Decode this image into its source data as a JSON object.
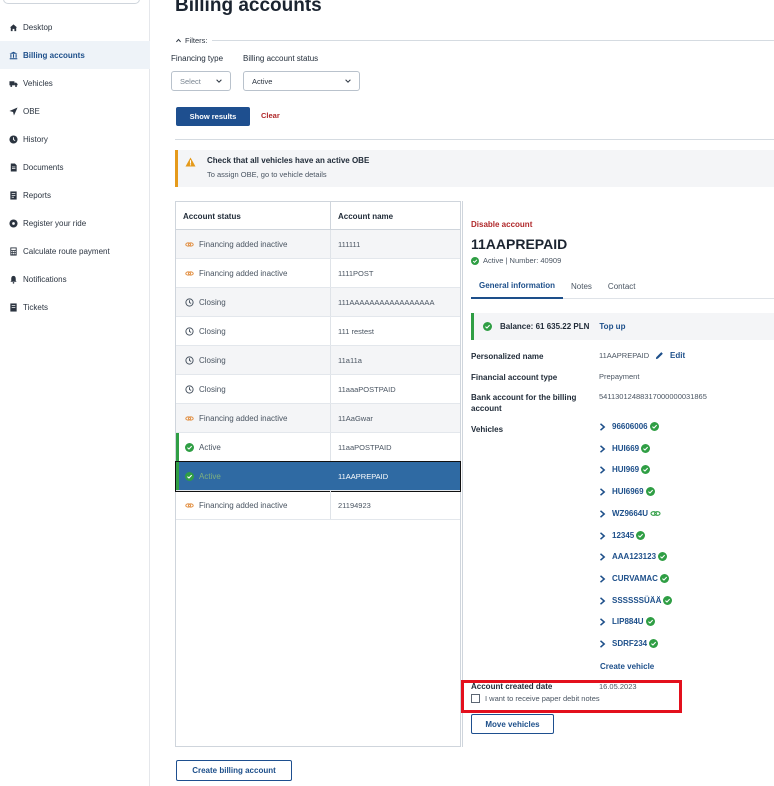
{
  "sidebar": {
    "items": [
      {
        "label": "Desktop",
        "icon": "home-icon",
        "active": false
      },
      {
        "label": "Billing accounts",
        "icon": "bank-icon",
        "active": true
      },
      {
        "label": "Vehicles",
        "icon": "truck-icon",
        "active": false
      },
      {
        "label": "OBE",
        "icon": "location-arrow-icon",
        "active": false
      },
      {
        "label": "History",
        "icon": "clock-icon",
        "active": false
      },
      {
        "label": "Documents",
        "icon": "document-icon",
        "active": false
      },
      {
        "label": "Reports",
        "icon": "report-icon",
        "active": false
      },
      {
        "label": "Register your ride",
        "icon": "register-icon",
        "active": false
      },
      {
        "label": "Calculate route payment",
        "icon": "calculator-icon",
        "active": false
      },
      {
        "label": "Notifications",
        "icon": "bell-icon",
        "active": false
      },
      {
        "label": "Tickets",
        "icon": "ticket-icon",
        "active": false
      }
    ]
  },
  "page": {
    "title": "Billing accounts",
    "filters_label": "Filters:",
    "financing_type_label": "Financing type",
    "financing_type_value": "Select",
    "status_label": "Billing account status",
    "status_value": "Active",
    "show_results": "Show results",
    "clear": "Clear",
    "create_billing_account": "Create billing account"
  },
  "warning": {
    "title": "Check that all vehicles have an active OBE",
    "subtitle": "To assign OBE, go to vehicle details"
  },
  "table": {
    "headers": [
      "Account status",
      "Account name"
    ],
    "rows": [
      {
        "status": "Financing added inactive",
        "name": "111111",
        "type": "financing"
      },
      {
        "status": "Financing added inactive",
        "name": "1111POST",
        "type": "financing"
      },
      {
        "status": "Closing",
        "name": "111AAAAAAAAAAAAAAAAA",
        "type": "closing"
      },
      {
        "status": "Closing",
        "name": "111 restest",
        "type": "closing"
      },
      {
        "status": "Closing",
        "name": "11a11a",
        "type": "closing"
      },
      {
        "status": "Closing",
        "name": "11aaaPOSTPAID",
        "type": "closing"
      },
      {
        "status": "Financing added inactive",
        "name": "11AaGwar",
        "type": "financing"
      },
      {
        "status": "Active",
        "name": "11aaPOSTPAID",
        "type": "active"
      },
      {
        "status": "Active",
        "name": "11AAPREPAID",
        "type": "active",
        "selected": true
      },
      {
        "status": "Financing added inactive",
        "name": "21194923",
        "type": "financing"
      }
    ]
  },
  "detail": {
    "disable_account": "Disable account",
    "account_title": "11AAPREPAID",
    "account_sub": "Active | Number: 40909",
    "tabs": [
      "General information",
      "Notes",
      "Contact"
    ],
    "balance": "Balance: 61 635.22 PLN",
    "top_up": "Top up",
    "personalized_name_label": "Personalized name",
    "personalized_name_value": "11AAPREPAID",
    "edit": "Edit",
    "financial_type_label": "Financial account type",
    "financial_type_value": "Prepayment",
    "bank_account_label": "Bank account for the billing account",
    "bank_account_value": "54113012488317000000031865",
    "vehicles_label": "Vehicles",
    "vehicles": [
      {
        "plate": "96606006",
        "status": "ok"
      },
      {
        "plate": "HUI669",
        "status": "ok"
      },
      {
        "plate": "HUI969",
        "status": "ok"
      },
      {
        "plate": "HUI6969",
        "status": "ok"
      },
      {
        "plate": "WZ9664U",
        "status": "linked"
      },
      {
        "plate": "12345",
        "status": "ok"
      },
      {
        "plate": "AAA123123",
        "status": "ok"
      },
      {
        "plate": "CURVAMAC",
        "status": "ok"
      },
      {
        "plate": "SSSSSSÜÄÄ",
        "status": "ok"
      },
      {
        "plate": "LIP884U",
        "status": "ok"
      },
      {
        "plate": "SDRF234",
        "status": "ok"
      }
    ],
    "create_vehicle": "Create vehicle",
    "created_date_label": "Account created date",
    "created_date_value": "16.05.2023",
    "paper_notes_label": "I want to receive paper debit notes",
    "move_vehicles": "Move vehicles"
  },
  "colors": {
    "primary": "#1e4f8f",
    "danger": "#b0282a",
    "success": "#2f9e44",
    "warning": "#e59a1b",
    "selected_row": "#2f6aa3",
    "highlight_box": "#e3101d"
  }
}
